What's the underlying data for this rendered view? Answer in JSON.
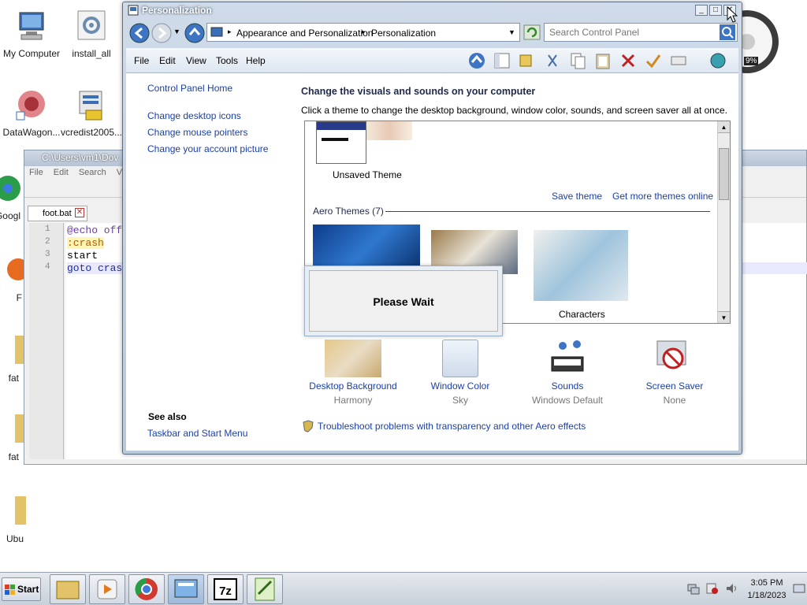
{
  "desktop": {
    "icons": [
      {
        "label": "My Computer"
      },
      {
        "label": "install_all"
      },
      {
        "label": "DataWagon..."
      },
      {
        "label": "vcredist2005..."
      },
      {
        "label": "Googl"
      },
      {
        "label": "F"
      },
      {
        "label": "fat"
      },
      {
        "label": "fat"
      },
      {
        "label": "Ubu"
      }
    ]
  },
  "editor": {
    "title": "C:\\Users\\vm1\\Dov",
    "menu": [
      "File",
      "Edit",
      "Search",
      "Vie"
    ],
    "tab": "foot.bat",
    "line_numbers": [
      "1",
      "2",
      "3",
      "4"
    ],
    "lines": [
      "@echo off",
      ":crash",
      "start",
      "goto cras"
    ]
  },
  "window": {
    "title": "Personalization",
    "breadcrumb": [
      "Appearance and Personalization",
      "Personalization"
    ],
    "search_placeholder": "Search Control Panel",
    "menu": [
      "File",
      "Edit",
      "View",
      "Tools",
      "Help"
    ]
  },
  "sidebar": {
    "home": "Control Panel Home",
    "links": [
      "Change desktop icons",
      "Change mouse pointers",
      "Change your account picture"
    ],
    "see_also_title": "See also",
    "see_also": [
      "Taskbar and Start Menu"
    ]
  },
  "main": {
    "heading": "Change the visuals and sounds on your computer",
    "subheading": "Click a theme to change the desktop background, window color, sounds, and screen saver all at once.",
    "unsaved_theme": "Unsaved Theme",
    "save_theme": "Save theme",
    "more_themes": "Get more themes online",
    "aero_group": "Aero Themes (7)",
    "characters": "Characters",
    "settings": [
      {
        "label": "Desktop Background",
        "value": "Harmony"
      },
      {
        "label": "Window Color",
        "value": "Sky"
      },
      {
        "label": "Sounds",
        "value": "Windows Default"
      },
      {
        "label": "Screen Saver",
        "value": "None"
      }
    ],
    "troubleshoot": "Troubleshoot problems with transparency and other Aero effects"
  },
  "dialog": {
    "text": "Please Wait"
  },
  "gadget": {
    "percent": "9%"
  },
  "taskbar": {
    "start": "Start",
    "time": "3:05 PM",
    "date": "1/18/2023"
  },
  "colors": {
    "link": "#1a3fa8",
    "title_bar": "#b8c9dc"
  }
}
